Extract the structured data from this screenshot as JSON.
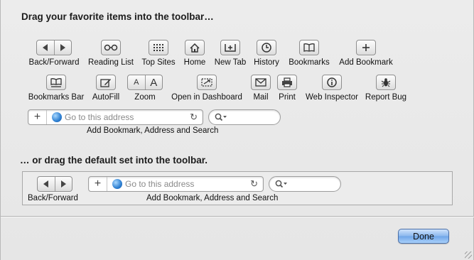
{
  "heading_favorites": "Drag your favorite items into the toolbar…",
  "heading_default": "… or drag the default set into the toolbar.",
  "items": [
    {
      "label": "Back/Forward",
      "icon": "back-forward-icon"
    },
    {
      "label": "Reading List",
      "icon": "reading-list-icon"
    },
    {
      "label": "Top Sites",
      "icon": "top-sites-icon"
    },
    {
      "label": "Home",
      "icon": "home-icon"
    },
    {
      "label": "New Tab",
      "icon": "new-tab-icon"
    },
    {
      "label": "History",
      "icon": "history-icon"
    },
    {
      "label": "Bookmarks",
      "icon": "bookmarks-icon"
    },
    {
      "label": "Add Bookmark",
      "icon": "add-bookmark-icon"
    },
    {
      "label": "Bookmarks Bar",
      "icon": "bookmarks-bar-icon"
    },
    {
      "label": "AutoFill",
      "icon": "autofill-icon"
    },
    {
      "label": "Zoom",
      "icon": "zoom-icon"
    },
    {
      "label": "Open in Dashboard",
      "icon": "dashboard-icon"
    },
    {
      "label": "Mail",
      "icon": "mail-icon"
    },
    {
      "label": "Print",
      "icon": "print-icon"
    },
    {
      "label": "Web Inspector",
      "icon": "web-inspector-icon"
    },
    {
      "label": "Report Bug",
      "icon": "bug-icon"
    }
  ],
  "address_bar": {
    "placeholder": "Go to this address",
    "label": "Add Bookmark, Address and Search"
  },
  "default_set": {
    "back_forward_label": "Back/Forward",
    "address_placeholder": "Go to this address",
    "combo_label": "Add Bookmark, Address and Search"
  },
  "zoom_glyphs": [
    "A",
    "A"
  ],
  "done_label": "Done",
  "colors": {
    "done_button": "#8ab7ee",
    "background": "#ececec"
  }
}
